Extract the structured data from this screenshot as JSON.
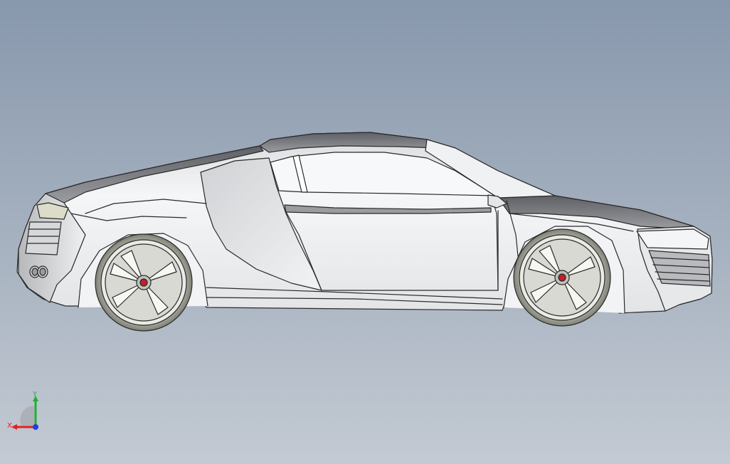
{
  "viewport": {
    "background_top": "#8898ad",
    "background_bottom": "#c3cad3"
  },
  "model": {
    "edge_color": "#2a2a2a",
    "body_color": "#eceef0",
    "dark_panel_color": "#6e7075",
    "glass_color": "#f4f5f6",
    "hub_color": "#c0202a",
    "icon": "car-side-view-icon"
  },
  "triad": {
    "x_label": "X",
    "y_label": "Y",
    "x_color": "#e02020",
    "y_color": "#20b030",
    "z_color": "#2040e0"
  }
}
